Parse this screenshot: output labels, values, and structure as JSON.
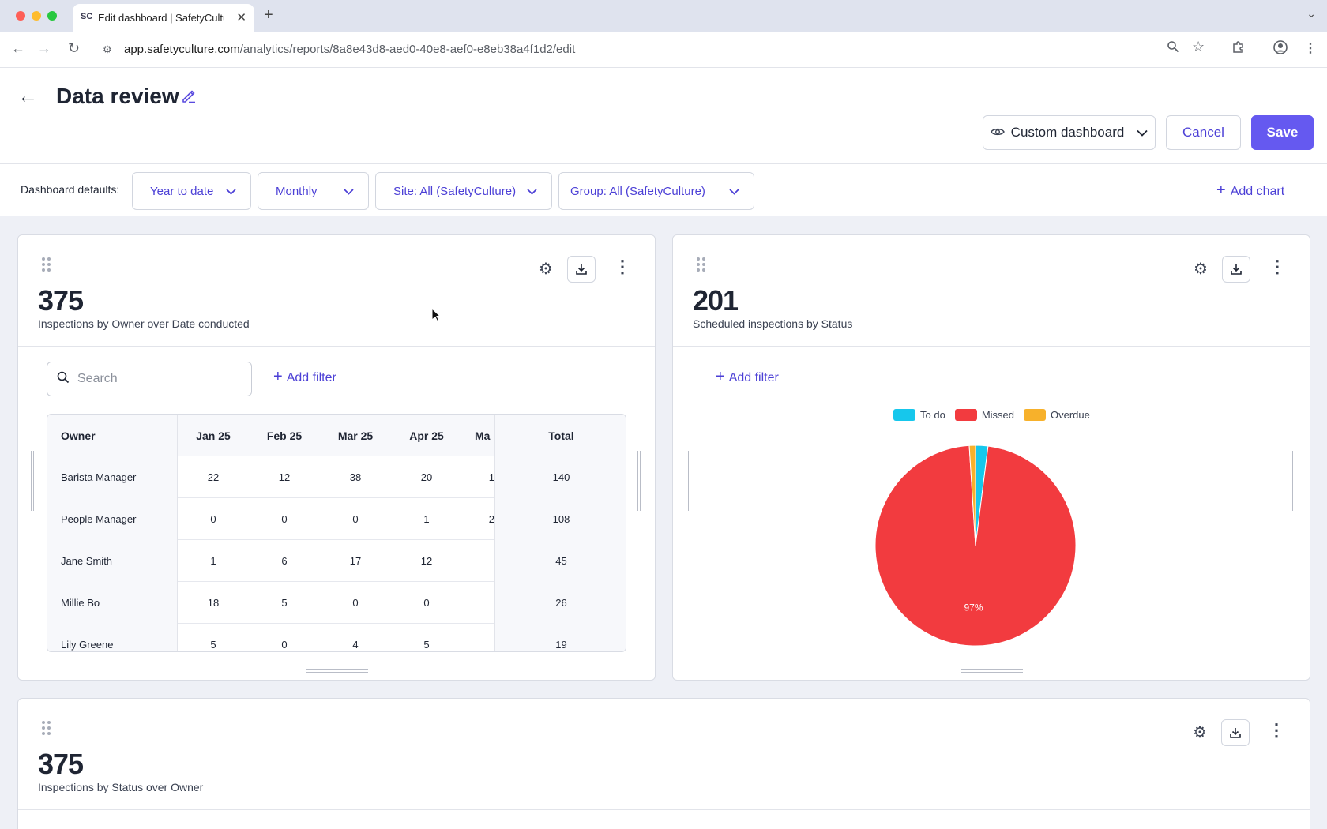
{
  "browser": {
    "tab_title": "Edit dashboard | SafetyCulture",
    "favicon": "SC",
    "url_host": "app.safetyculture.com",
    "url_path": "/analytics/reports/8a8e43d8-aed0-40e8-aef0-e8eb38a4f1d2/edit"
  },
  "header": {
    "title": "Data review",
    "view_select": "Custom dashboard",
    "cancel_label": "Cancel",
    "save_label": "Save"
  },
  "filters": {
    "label": "Dashboard defaults:",
    "date_range": "Year to date",
    "interval": "Monthly",
    "site": "Site: All (SafetyCulture)",
    "group": "Group: All (SafetyCulture)",
    "add_chart": "Add chart"
  },
  "cards": [
    {
      "metric": "375",
      "subtitle": "Inspections by Owner over Date conducted",
      "search_placeholder": "Search",
      "add_filter": "Add filter",
      "table": {
        "headers": [
          "Owner",
          "Jan 25",
          "Feb 25",
          "Mar 25",
          "Apr 25",
          "Ma",
          "Total"
        ],
        "rows": [
          [
            "Barista Manager",
            "22",
            "12",
            "38",
            "20",
            "1",
            "140"
          ],
          [
            "People Manager",
            "0",
            "0",
            "0",
            "1",
            "2",
            "108"
          ],
          [
            "Jane Smith",
            "1",
            "6",
            "17",
            "12",
            "",
            "45"
          ],
          [
            "Millie Bo",
            "18",
            "5",
            "0",
            "0",
            "",
            "26"
          ],
          [
            "Lily Greene",
            "5",
            "0",
            "4",
            "5",
            "",
            "19"
          ]
        ]
      }
    },
    {
      "metric": "201",
      "subtitle": "Scheduled inspections by Status",
      "add_filter": "Add filter"
    },
    {
      "metric": "375",
      "subtitle": "Inspections by Status over Owner"
    }
  ],
  "chart_data": {
    "type": "pie",
    "labels": [
      "To do",
      "Missed",
      "Overdue"
    ],
    "values": [
      2,
      97,
      1
    ],
    "colors": [
      "#16c7ec",
      "#f23b3f",
      "#f7b12b"
    ],
    "data_labels": [
      "",
      "97%",
      ""
    ],
    "legend": "top"
  }
}
